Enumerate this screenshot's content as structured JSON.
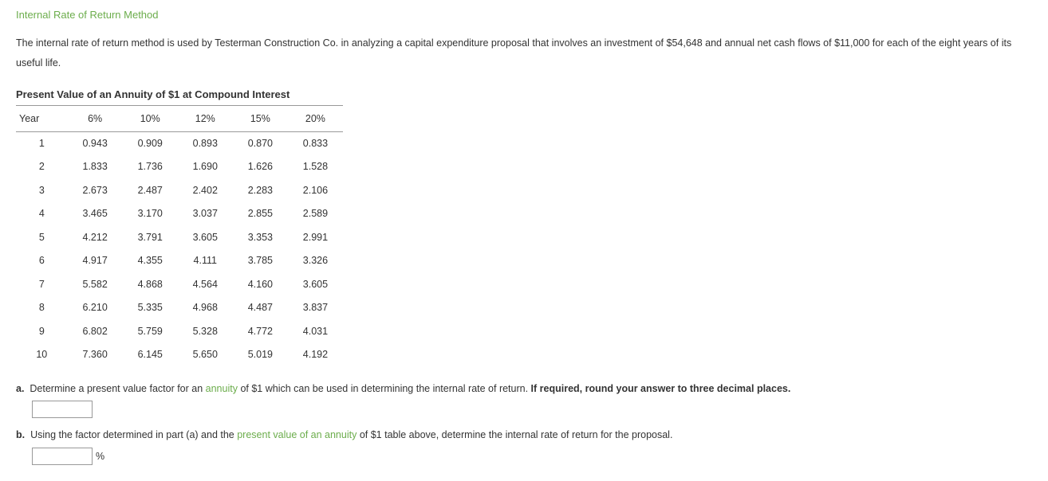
{
  "title": "Internal Rate of Return Method",
  "problem_text": "The internal rate of return method is used by Testerman Construction Co. in analyzing a capital expenditure proposal that involves an investment of $54,648 and annual net cash flows of $11,000 for each of the eight years of its useful life.",
  "table": {
    "title": "Present Value of an Annuity of $1 at Compound Interest",
    "headers": [
      "Year",
      "6%",
      "10%",
      "12%",
      "15%",
      "20%"
    ],
    "rows": [
      [
        "1",
        "0.943",
        "0.909",
        "0.893",
        "0.870",
        "0.833"
      ],
      [
        "2",
        "1.833",
        "1.736",
        "1.690",
        "1.626",
        "1.528"
      ],
      [
        "3",
        "2.673",
        "2.487",
        "2.402",
        "2.283",
        "2.106"
      ],
      [
        "4",
        "3.465",
        "3.170",
        "3.037",
        "2.855",
        "2.589"
      ],
      [
        "5",
        "4.212",
        "3.791",
        "3.605",
        "3.353",
        "2.991"
      ],
      [
        "6",
        "4.917",
        "4.355",
        "4.111",
        "3.785",
        "3.326"
      ],
      [
        "7",
        "5.582",
        "4.868",
        "4.564",
        "4.160",
        "3.605"
      ],
      [
        "8",
        "6.210",
        "5.335",
        "4.968",
        "4.487",
        "3.837"
      ],
      [
        "9",
        "6.802",
        "5.759",
        "5.328",
        "4.772",
        "4.031"
      ],
      [
        "10",
        "7.360",
        "6.145",
        "5.650",
        "5.019",
        "4.192"
      ]
    ]
  },
  "question_a": {
    "label": "a.",
    "text_before": "Determine a present value factor for an ",
    "link": "annuity",
    "text_after": " of $1 which can be used in determining the internal rate of return. ",
    "bold_text": "If required, round your answer to three decimal places."
  },
  "question_b": {
    "label": "b.",
    "text_before": "Using the factor determined in part (a) and the ",
    "link": "present value of an annuity",
    "text_after": " of $1 table above, determine the internal rate of return for the proposal.",
    "unit": "%"
  }
}
